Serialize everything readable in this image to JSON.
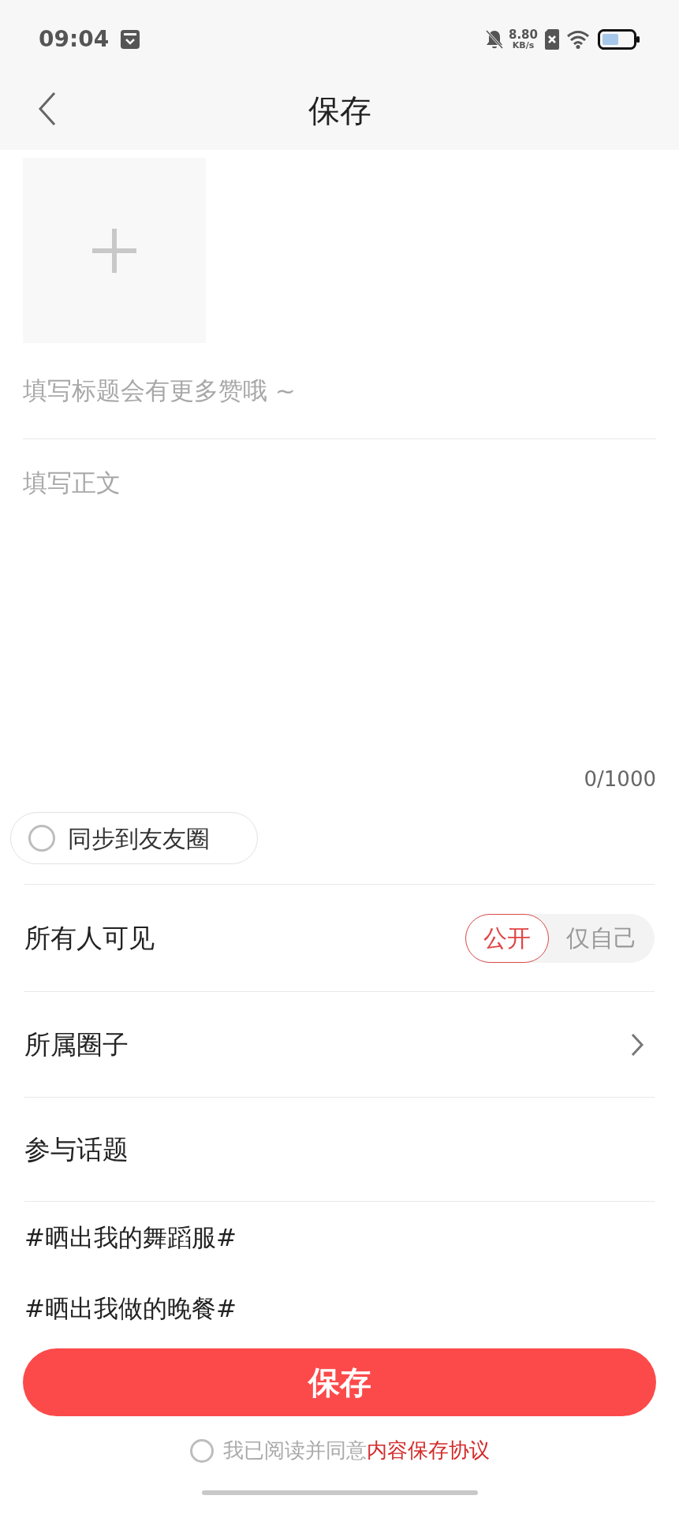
{
  "status_bar": {
    "time": "09:04",
    "net_speed_value": "8.80",
    "net_speed_unit": "KB/s"
  },
  "header": {
    "title": "保存"
  },
  "title_field": {
    "placeholder": "填写标题会有更多赞哦 ~"
  },
  "body_field": {
    "placeholder": "填写正文",
    "counter": "0/1000"
  },
  "sync": {
    "label": "同步到友友圈",
    "checked": false
  },
  "visibility": {
    "label": "所有人可见",
    "options": [
      {
        "label": "公开",
        "selected": true
      },
      {
        "label": "仅自己",
        "selected": false
      }
    ]
  },
  "circle": {
    "label": "所属圈子"
  },
  "topics": {
    "label": "参与话题",
    "items": [
      "#晒出我的舞蹈服#",
      "#晒出我做的晚餐#"
    ]
  },
  "save_button": "保存",
  "agreement": {
    "text": "我已阅读并同意",
    "link": "内容保存协议",
    "checked": false
  }
}
